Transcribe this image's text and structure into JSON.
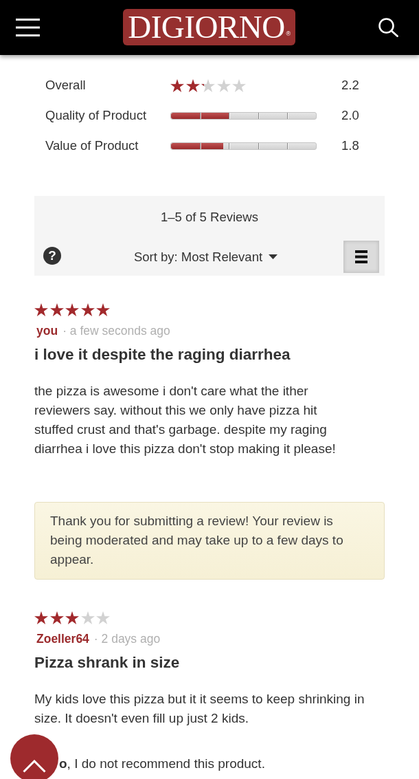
{
  "header": {
    "logo": {
      "name": "DIGIORNO",
      "mark": "®"
    }
  },
  "ratings": [
    {
      "label": "Overall",
      "kind": "stars",
      "stars": 2.2,
      "value": "2.2"
    },
    {
      "label": "Quality of Product",
      "kind": "bar",
      "level": 0.4,
      "value": "2.0"
    },
    {
      "label": "Value of Product",
      "kind": "bar",
      "level": 0.36,
      "value": "1.8"
    }
  ],
  "toolbar": {
    "count": "1–5 of 5 Reviews",
    "help": "?",
    "sort": "Sort by: Most Relevant"
  },
  "reviews": [
    {
      "stars": 5,
      "author": "you",
      "time": "· a few seconds ago",
      "title": "i love it despite the raging diarrhea",
      "body": "the pizza is awesome i don't care what the ither reviewers say. without this we only have pizza hit stuffed crust and that's garbage. despite my raging diarrhea i love this pizza don't stop making it please!",
      "notice": "Thank you for submitting a review! Your review is being moderated and may take up to a few days to appear."
    },
    {
      "stars": 3,
      "author": "Zoeller64",
      "time": "· 2 days ago",
      "title": "Pizza shrank in size",
      "body": "My kids love this pizza but it it seems to keep shrinking in size. It doesn't even fill up just 2 kids.",
      "recommendation": "**o**, I do not recommend this product."
    }
  ]
}
